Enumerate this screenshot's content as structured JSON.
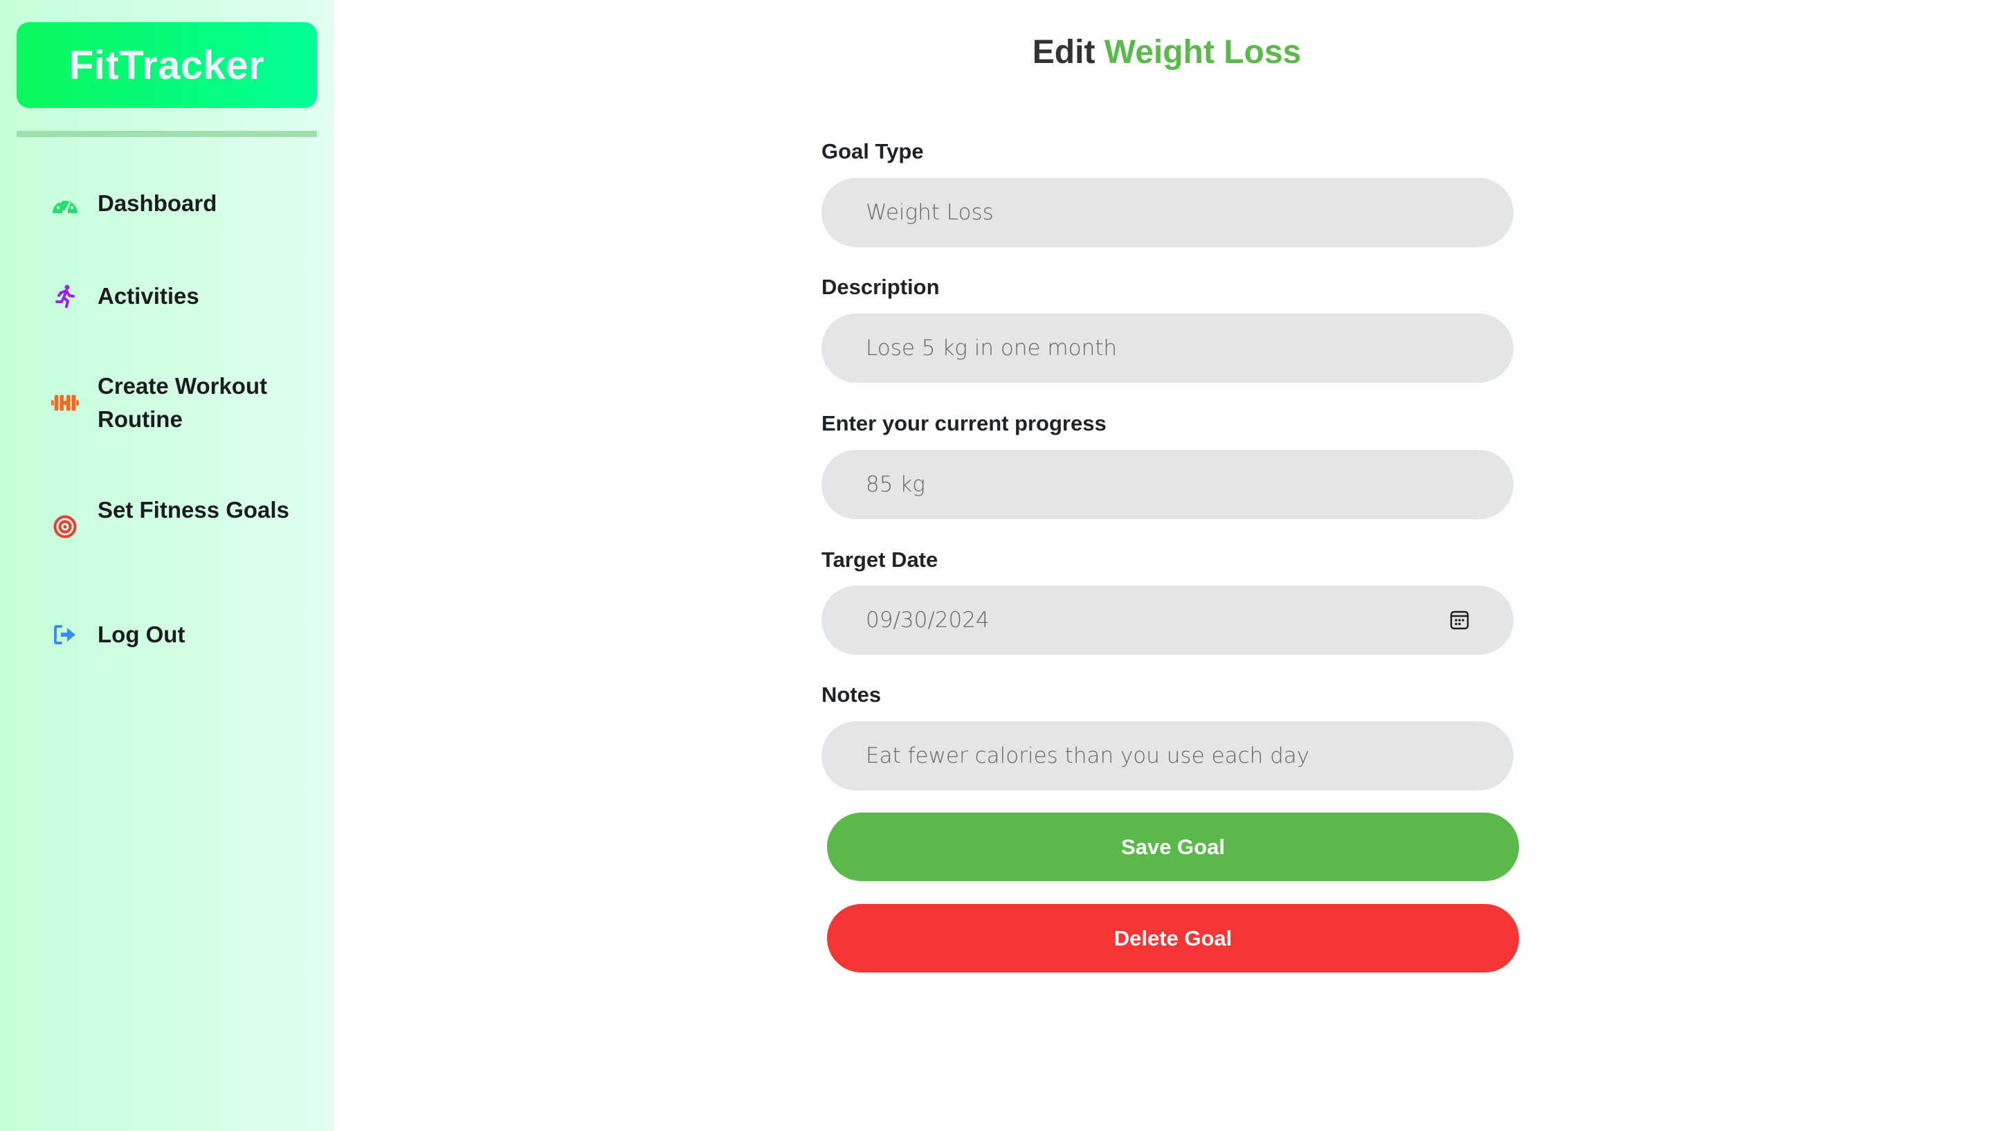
{
  "app": {
    "brand": "FitTracker",
    "colors": {
      "brand_gradient_start": "#0bf75e",
      "brand_gradient_end": "#00ff94",
      "accent_green": "#5bb94b",
      "danger_red": "#f43535"
    }
  },
  "sidebar": {
    "items": [
      {
        "label": "Dashboard",
        "icon": "dashboard-gauge-icon",
        "icon_color": "#22e06a"
      },
      {
        "label": "Activities",
        "icon": "running-person-icon",
        "icon_color": "#9b1ff0"
      },
      {
        "label": "Create Workout Routine",
        "icon": "dumbbell-icon",
        "icon_color": "#f26a1f"
      },
      {
        "label": "Set Fitness Goals",
        "icon": "target-icon",
        "icon_color": "#f23a35"
      },
      {
        "label": "Log Out",
        "icon": "logout-icon",
        "icon_color": "#3b8df5"
      }
    ]
  },
  "page": {
    "title_prefix": "Edit",
    "title_goal": "Weight Loss"
  },
  "form": {
    "goal_type": {
      "label": "Goal Type",
      "value": "Weight Loss"
    },
    "description": {
      "label": "Description",
      "value": "Lose 5 kg in one month"
    },
    "progress": {
      "label": "Enter your current progress",
      "value": "85 kg"
    },
    "target_date": {
      "label": "Target Date",
      "value": "09/30/2024",
      "icon": "calendar-icon"
    },
    "notes": {
      "label": "Notes",
      "value": "Eat fewer calories than you use each day"
    },
    "save_label": "Save Goal",
    "delete_label": "Delete Goal"
  }
}
